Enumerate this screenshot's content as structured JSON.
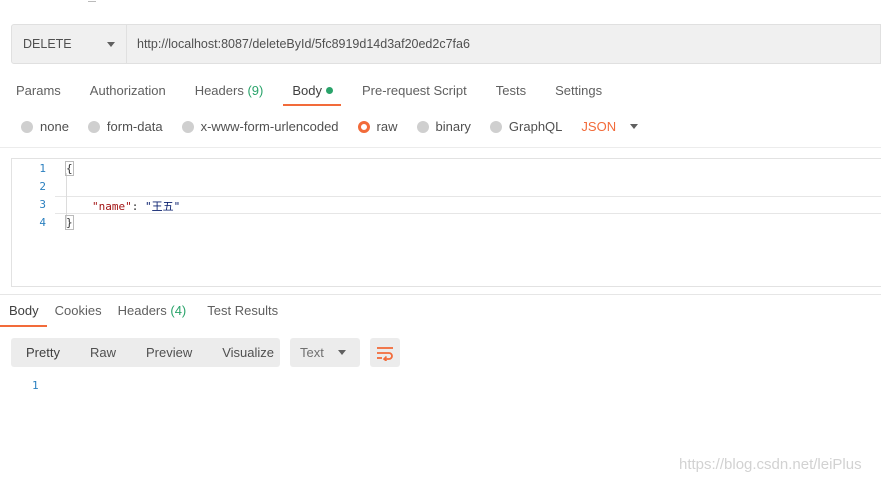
{
  "request": {
    "method": "DELETE",
    "url": "http://localhost:8087/deleteById/5fc8919d14d3af20ed2c7fa6"
  },
  "request_tabs": {
    "params": "Params",
    "authorization": "Authorization",
    "headers": "Headers",
    "headers_count": "(9)",
    "body": "Body",
    "prerequest": "Pre-request Script",
    "tests": "Tests",
    "settings": "Settings",
    "active": "Body"
  },
  "body_types": {
    "none": "none",
    "form_data": "form-data",
    "urlencoded": "x-www-form-urlencoded",
    "raw": "raw",
    "binary": "binary",
    "graphql": "GraphQL",
    "selected": "raw",
    "language": "JSON"
  },
  "editor": {
    "line_numbers": [
      "1",
      "2",
      "3",
      "4"
    ],
    "open_brace": "{",
    "key": "\"name\"",
    "colon": ": ",
    "value": "\"王五\"",
    "close_brace": "}"
  },
  "response_tabs": {
    "body": "Body",
    "cookies": "Cookies",
    "headers": "Headers",
    "headers_count": "(4)",
    "test_results": "Test Results",
    "active": "Body"
  },
  "response_view": {
    "pretty": "Pretty",
    "raw": "Raw",
    "preview": "Preview",
    "visualize": "Visualize",
    "active": "Pretty",
    "format": "Text",
    "line_numbers": [
      "1"
    ]
  },
  "icons": {
    "method_dropdown": "chevron-down-icon",
    "wrap": "text-wrap-icon",
    "body_indicator": "status-dot-icon"
  },
  "colors": {
    "accent": "#f26b3a",
    "count": "#29a36a",
    "line_number": "#2a7fbf"
  },
  "watermark": "https://blog.csdn.net/leiPlus"
}
